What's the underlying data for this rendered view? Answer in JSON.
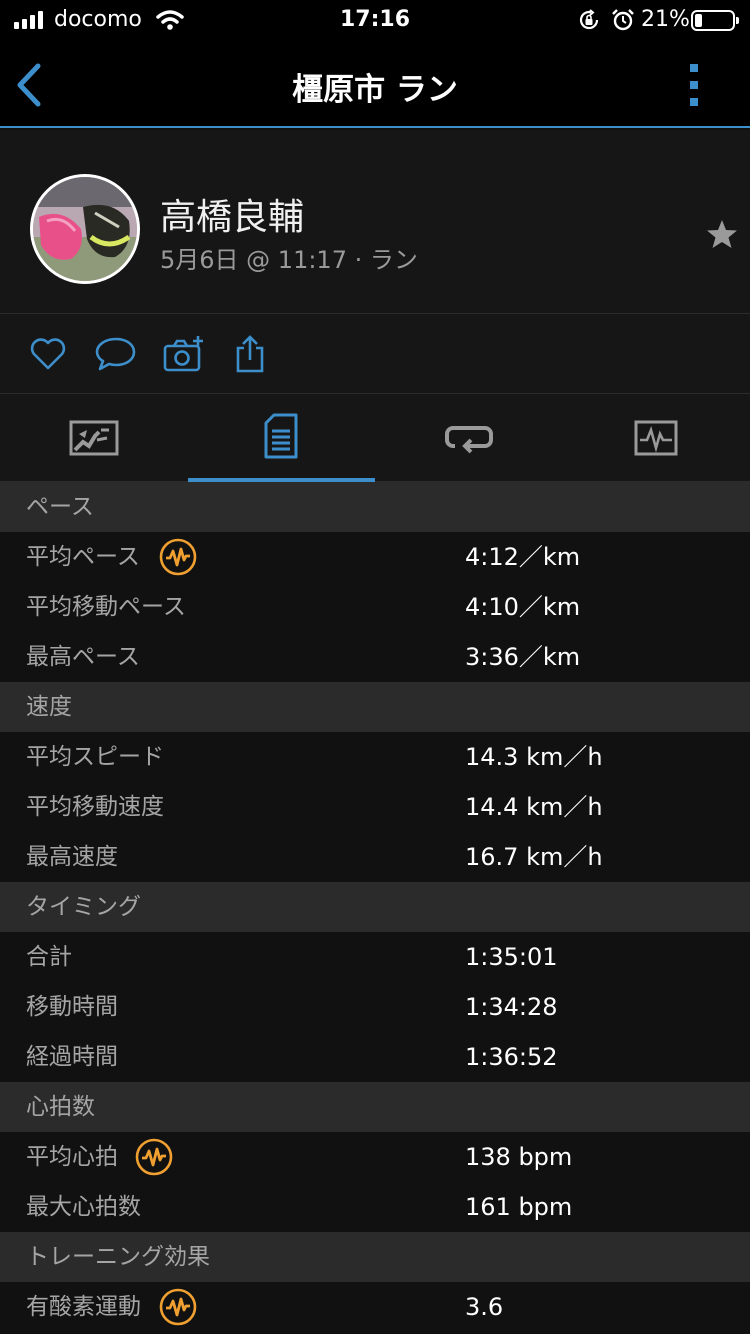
{
  "status_bar": {
    "carrier": "docomo",
    "time": "17:16",
    "battery": "21%",
    "battery_level": 0.21
  },
  "nav": {
    "title": "橿原市 ラン",
    "back_icon": "chevron-left-icon",
    "more_icon": "more-vertical-icon"
  },
  "profile": {
    "name": "高橋良輔",
    "meta": "5月6日 @ 11:17 · ラン"
  },
  "actions": [
    "heart-icon",
    "comment-icon",
    "add-photo-icon",
    "share-icon"
  ],
  "tabs": [
    "map-icon",
    "stats-icon",
    "laps-icon",
    "charts-icon"
  ],
  "stats": {
    "pace": {
      "header": "ペース",
      "rows": [
        {
          "label": "平均ペース",
          "value": "4:12／km"
        },
        {
          "label": "平均移動ペース",
          "value": "4:10／km"
        },
        {
          "label": "最高ペース",
          "value": "3:36／km"
        }
      ]
    },
    "speed": {
      "header": "速度",
      "rows": [
        {
          "label": "平均スピード",
          "value": "14.3 km／h"
        },
        {
          "label": "平均移動速度",
          "value": "14.4 km／h"
        },
        {
          "label": "最高速度",
          "value": "16.7 km／h"
        }
      ]
    },
    "timing": {
      "header": "タイミング",
      "rows": [
        {
          "label": "合計",
          "value": "1:35:01"
        },
        {
          "label": "移動時間",
          "value": "1:34:28"
        },
        {
          "label": "経過時間",
          "value": "1:36:52"
        }
      ]
    },
    "heart_rate": {
      "header": "心拍数",
      "rows": [
        {
          "label": "平均心拍",
          "value": "138 bpm"
        },
        {
          "label": "最大心拍数",
          "value": "161 bpm"
        }
      ]
    },
    "training_effect": {
      "header": "トレーニング効果",
      "rows": [
        {
          "label": "有酸素運動",
          "value": "3.6"
        }
      ]
    }
  },
  "colors": {
    "accent": "#3d8fcc",
    "badge": "#f0a030",
    "background": "#111111",
    "section_header": "#2b2b2b"
  }
}
